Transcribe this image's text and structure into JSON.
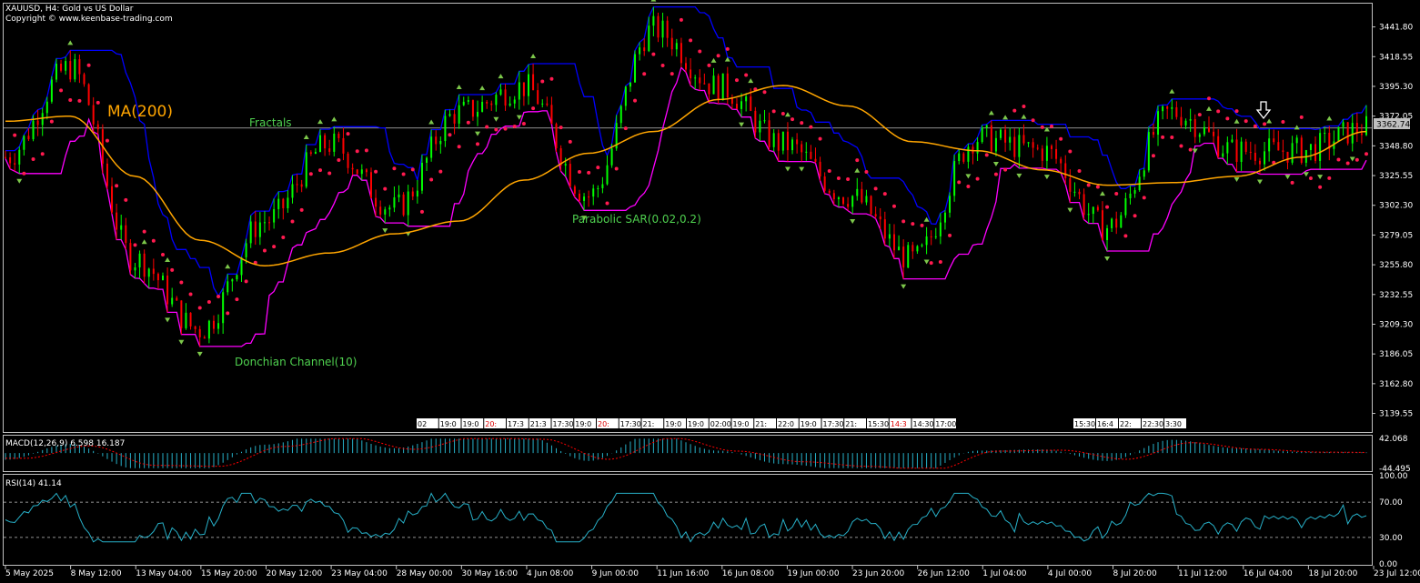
{
  "header": {
    "symbol_line": "XAUUSD, H4:  Gold vs US Dollar",
    "copyright": "Copyright © www.keenbase-trading.com"
  },
  "annotations": {
    "ma": "MA(200)",
    "fractals": "Fractals",
    "sar": "Parabolic SAR(0.02,0.2)",
    "donchian": "Donchian Channel(10)"
  },
  "current_price": "3362.74",
  "direction_icon": "down-arrow-icon",
  "colors": {
    "background": "#000000",
    "bull_candle": "#00ff00",
    "bear_candle": "#ff0000",
    "ma": "#ffa500",
    "donchian_upper": "#0000ff",
    "donchian_lower": "#ff00ff",
    "sar": "#ff1a4f",
    "fractal": "#7cc74a",
    "macd": "#27b0c8",
    "macd_signal": "#ff0000",
    "rsi": "#27b0c8"
  },
  "time_labels": [
    "5 May 2025",
    "8 May 12:00",
    "13 May 04:00",
    "15 May 20:00",
    "20 May 12:00",
    "23 May 04:00",
    "28 May 00:00",
    "30 May 16:00",
    "4 Jun 08:00",
    "9 Jun 00:00",
    "11 Jun 16:00",
    "16 Jun 08:00",
    "19 Jun 00:00",
    "23 Jun 20:00",
    "26 Jun 12:00",
    "1 Jul 04:00",
    "4 Jul 00:00",
    "8 Jul 20:00",
    "11 Jul 12:00",
    "16 Jul 04:00",
    "18 Jul 20:00",
    "23 Jul 12:00"
  ],
  "session_markers": [
    "02",
    "19:0",
    "19:0",
    "20:",
    "17:3",
    "21:3",
    "17:30",
    "19:0",
    "20:",
    "17:30",
    "21:",
    "19:0",
    "19:0",
    "02:00",
    "19:0",
    "21:",
    "22:0",
    "19:0",
    "17:30",
    "21:",
    "15:30",
    "14:3",
    "14:30",
    "17:00",
    "15:30",
    "16:4",
    "22:",
    "22:30",
    "3:30"
  ],
  "chart_data": [
    {
      "type": "line",
      "title": "XAUUSD, H4:  Gold vs US Dollar",
      "y_ticks": [
        3441.8,
        3418.55,
        3395.3,
        3372.05,
        3348.8,
        3325.55,
        3302.3,
        3279.05,
        3255.8,
        3232.55,
        3209.3,
        3186.05,
        3162.8,
        3139.55
      ],
      "ylim": [
        3125,
        3460
      ],
      "x": [
        "5 May 2025",
        "8 May 12:00",
        "13 May 04:00",
        "15 May 20:00",
        "20 May 12:00",
        "23 May 04:00",
        "28 May 00:00",
        "30 May 16:00",
        "4 Jun 08:00",
        "9 Jun 00:00",
        "11 Jun 16:00",
        "16 Jun 08:00",
        "19 Jun 00:00",
        "23 Jun 20:00",
        "26 Jun 12:00",
        "1 Jul 04:00",
        "4 Jul 00:00",
        "8 Jul 20:00",
        "11 Jul 12:00",
        "16 Jul 04:00",
        "18 Jul 20:00",
        "23 Jul 12:00"
      ],
      "series": [
        {
          "name": "Price",
          "values": [
            3340,
            3410,
            3260,
            3205,
            3290,
            3350,
            3300,
            3375,
            3395,
            3310,
            3440,
            3395,
            3350,
            3310,
            3260,
            3355,
            3345,
            3285,
            3375,
            3345,
            3345,
            3362.74
          ]
        },
        {
          "name": "MA(200)",
          "values": [
            3368,
            3372,
            3325,
            3275,
            3255,
            3265,
            3280,
            3290,
            3322,
            3343,
            3360,
            3385,
            3396,
            3380,
            3352,
            3345,
            3330,
            3318,
            3320,
            3325,
            3340,
            3360
          ]
        }
      ],
      "grid": false
    },
    {
      "type": "bar",
      "title": "MACD(12,26,9) 6.598 16.187",
      "y_ticks": [
        42.068,
        -44.495
      ],
      "ylim": [
        -50,
        48
      ]
    },
    {
      "type": "line",
      "title": "RSI(14) 41.14",
      "y_ticks": [
        100.0,
        70.0,
        30.0,
        0.0
      ],
      "ylim": [
        0,
        100
      ],
      "levels": [
        70,
        30
      ]
    }
  ]
}
